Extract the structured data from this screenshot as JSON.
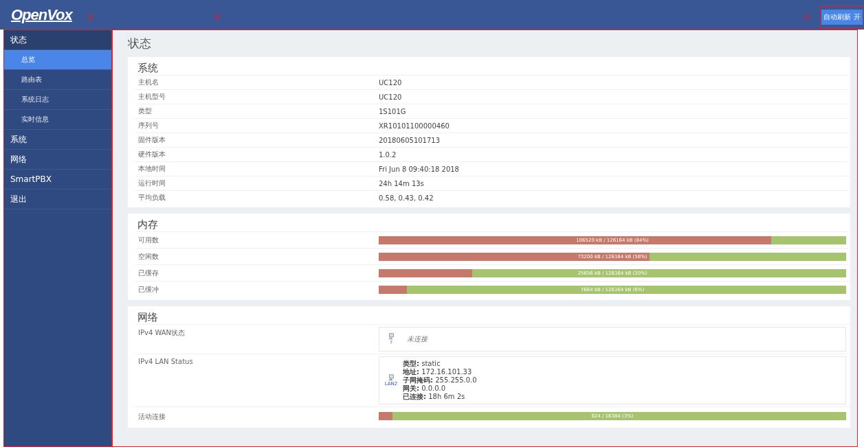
{
  "header": {
    "logo": "OpenVox",
    "annotations": [
      "②",
      "③",
      "①"
    ],
    "refresh_button": "自动刷新 开"
  },
  "sidebar": {
    "items": [
      {
        "label": "状态",
        "children": [
          {
            "label": "总览",
            "selected": true
          },
          {
            "label": "路由表",
            "selected": false
          },
          {
            "label": "系统日志",
            "selected": false
          },
          {
            "label": "实时信息",
            "selected": false
          }
        ]
      },
      {
        "label": "系统"
      },
      {
        "label": "网络"
      },
      {
        "label": "SmartPBX"
      },
      {
        "label": "退出"
      }
    ]
  },
  "page_title": "状态",
  "system": {
    "title": "系统",
    "rows": [
      {
        "label": "主机名",
        "value": "UC120"
      },
      {
        "label": "主机型号",
        "value": "UC120"
      },
      {
        "label": "类型",
        "value": "1S101G"
      },
      {
        "label": "序列号",
        "value": "XR10101100000460"
      },
      {
        "label": "固件版本",
        "value": "20180605101713"
      },
      {
        "label": "硬件版本",
        "value": "1.0.2"
      },
      {
        "label": "本地时间",
        "value": "Fri Jun 8 09:40:18 2018"
      },
      {
        "label": "运行时间",
        "value": "24h 14m 13s"
      },
      {
        "label": "平均负载",
        "value": "0.58, 0.43, 0.42"
      }
    ]
  },
  "memory": {
    "title": "内存",
    "rows": [
      {
        "label": "可用数",
        "level": 0.84,
        "reading": "106520 kB / 126164 kB (84%)"
      },
      {
        "label": "空闲数",
        "level": 0.58,
        "reading": "73200 kB / 126164 kB (58%)"
      },
      {
        "label": "已缓存",
        "level": 0.2,
        "reading": "25656 kB / 126164 kB (20%)"
      },
      {
        "label": "已缓冲",
        "level": 0.06,
        "reading": "7664 kB / 126164 kB (6%)"
      }
    ]
  },
  "network": {
    "title": "网络",
    "rows": [
      {
        "kind": "wan",
        "label": "IPv4 WAN状态",
        "icon_caption": "?",
        "status": "未连接"
      },
      {
        "kind": "lan",
        "label": "IPv4 LAN Status",
        "icon_caption": "LAN2",
        "lines": [
          "**类型:** static",
          "**地址:** 172.16.101.33",
          "**子网掩码:** 255.255.0.0",
          "**网关:** 0.0.0.0",
          "**已连接:** 18h 6m 2s"
        ]
      },
      {
        "kind": "bar",
        "label": "活动连接",
        "level": 0.03,
        "reading": "624 / 16384 (3%)"
      }
    ]
  }
}
